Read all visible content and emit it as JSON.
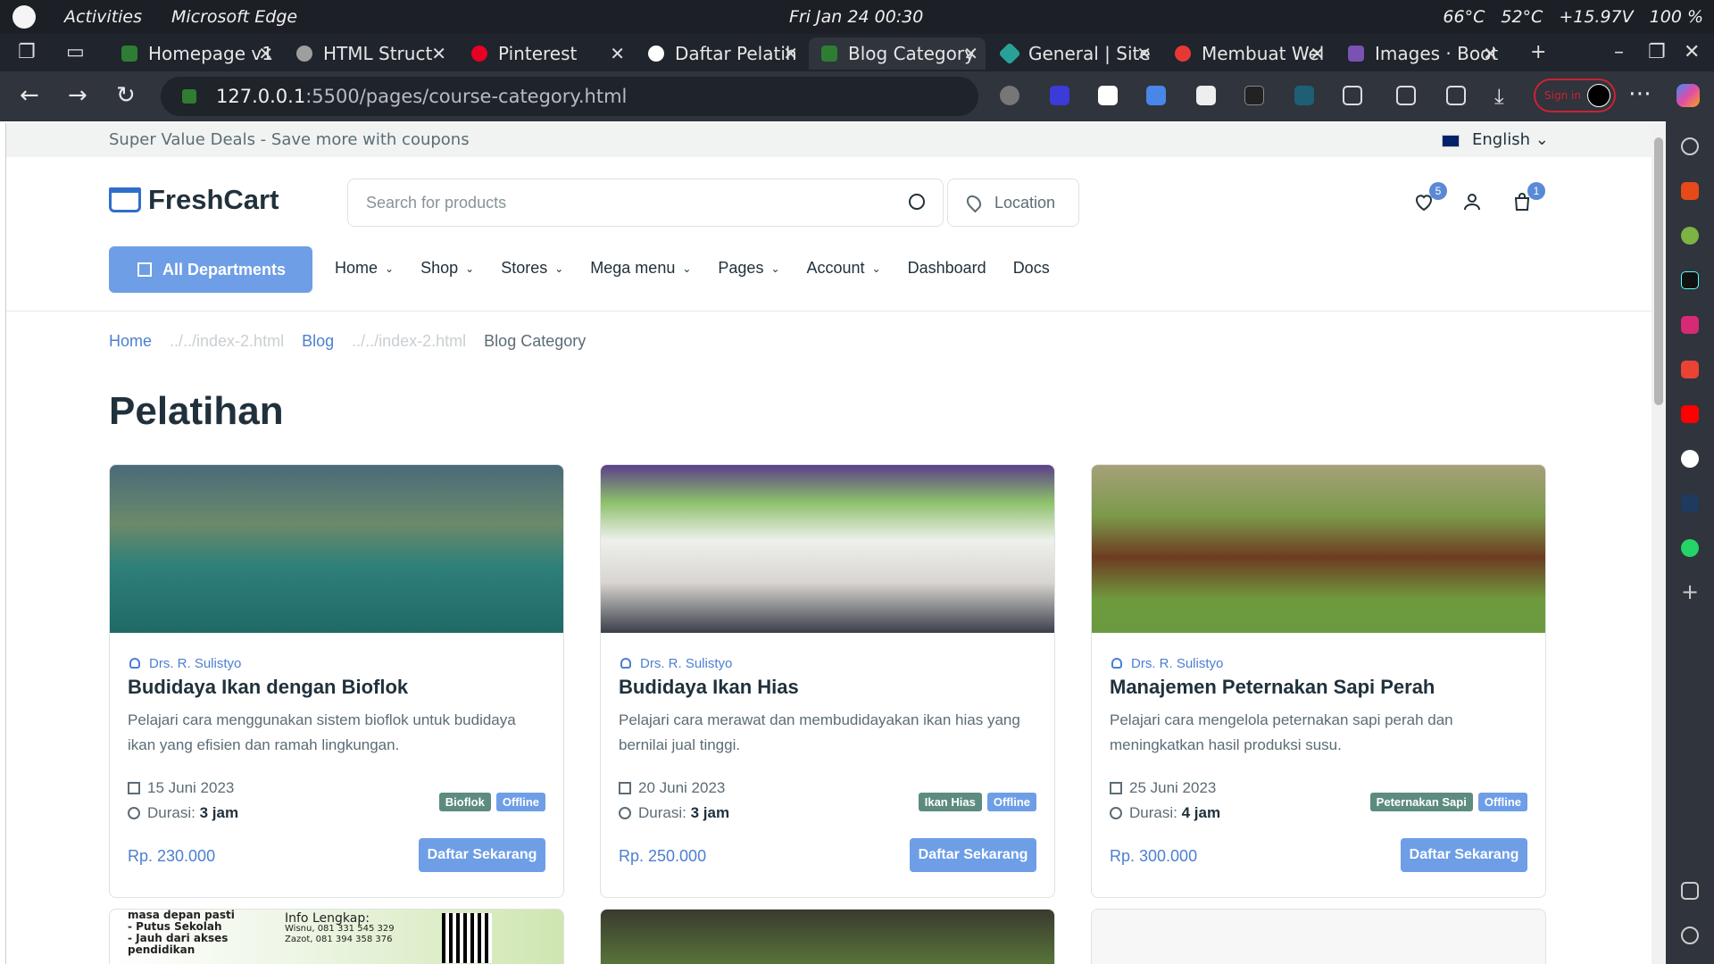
{
  "os": {
    "activities": "Activities",
    "app_name": "Microsoft Edge",
    "clock": "Fri Jan 24  00:30",
    "status": [
      "66°C",
      "52°C",
      "+15.97V",
      "100 %"
    ]
  },
  "browser": {
    "tabs": [
      {
        "label": "Homepage v1",
        "color": "#2e7d32"
      },
      {
        "label": "HTML Struct",
        "color": "#9e9e9e"
      },
      {
        "label": "Pinterest",
        "color": "#e60023"
      },
      {
        "label": "Daftar Pelatih",
        "color": "#ffffff"
      },
      {
        "label": "Blog Category",
        "color": "#2e7d32",
        "active": true
      },
      {
        "label": "General | Site",
        "color": "#2aa198"
      },
      {
        "label": "Membuat Wel",
        "color": "#e53935"
      },
      {
        "label": "Images · Boot",
        "color": "#7952b3"
      }
    ],
    "url_host": "127.0.0.1",
    "url_path": ":5500/pages/course-category.html",
    "signin": "Sign in"
  },
  "site": {
    "promo": "Super Value Deals - Save more with coupons",
    "language": "English",
    "brand": "FreshCart",
    "search_placeholder": "Search for products",
    "location": "Location",
    "wishlist_count": "5",
    "cart_count": "1",
    "all_departments": "All Departments",
    "nav": [
      {
        "label": "Home",
        "dropdown": true
      },
      {
        "label": "Shop",
        "dropdown": true
      },
      {
        "label": "Stores",
        "dropdown": true
      },
      {
        "label": "Mega menu",
        "dropdown": true
      },
      {
        "label": "Pages",
        "dropdown": true
      },
      {
        "label": "Account",
        "dropdown": true
      },
      {
        "label": "Dashboard",
        "dropdown": false
      },
      {
        "label": "Docs",
        "dropdown": false
      }
    ],
    "breadcrumb": {
      "home": "Home",
      "sep1": "../../index-2.html",
      "blog": "Blog",
      "sep2": "../../index-2.html",
      "current": "Blog Category"
    },
    "page_title": "Pelatihan",
    "courses": [
      {
        "author": "Drs. R. Sulistyo",
        "title": "Budidaya Ikan dengan Bioflok",
        "description": "Pelajari cara menggunakan sistem bioflok untuk budidaya ikan yang efisien dan ramah lingkungan.",
        "date": "15 Juni 2023",
        "duration_label": "Durasi:",
        "duration": "3 jam",
        "category": "Bioflok",
        "mode": "Offline",
        "price": "Rp. 230.000",
        "cta": "Daftar Sekarang"
      },
      {
        "author": "Drs. R. Sulistyo",
        "title": "Budidaya Ikan Hias",
        "description": "Pelajari cara merawat dan membudidayakan ikan hias yang bernilai jual tinggi.",
        "date": "20 Juni 2023",
        "duration_label": "Durasi:",
        "duration": "3 jam",
        "category": "Ikan Hias",
        "mode": "Offline",
        "price": "Rp. 250.000",
        "cta": "Daftar Sekarang"
      },
      {
        "author": "Drs. R. Sulistyo",
        "title": "Manajemen Peternakan Sapi Perah",
        "description": "Pelajari cara mengelola peternakan sapi perah dan meningkatkan hasil produksi susu.",
        "date": "25 Juni 2023",
        "duration_label": "Durasi:",
        "duration": "4 jam",
        "category": "Peternakan Sapi",
        "mode": "Offline",
        "price": "Rp. 300.000",
        "cta": "Daftar Sekarang"
      }
    ],
    "partial_card_text": {
      "line1": "masa depan pasti",
      "line2": "- Putus Sekolah",
      "line3": "- Jauh dari akses",
      "line4": "pendidikan",
      "info": "Info Lengkap:",
      "contact1": "Wisnu, 081 331 545 329",
      "contact2": "Zazot, 081 394 358 376"
    }
  },
  "colors": {
    "primary": "#6e9ee6",
    "link": "#4c7fd1",
    "category_tag": "#5d8b80",
    "text_dark": "#21313c",
    "text_muted": "#5c6c75"
  }
}
